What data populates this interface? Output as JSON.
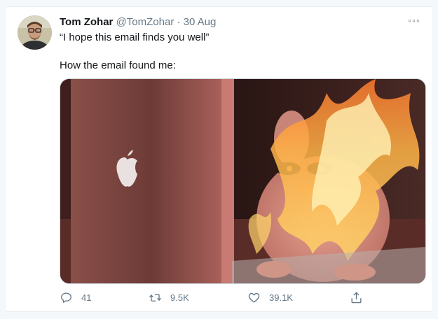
{
  "tweet": {
    "author_name": "Tom Zohar",
    "author_handle": "@TomZohar",
    "separator": "·",
    "date": "30 Aug",
    "text_line1": "“I hope this email finds you well”",
    "text_line2": "How the email found me:",
    "more_label": "◦◦◦"
  },
  "actions": {
    "replies": "41",
    "retweets": "9.5K",
    "likes": "39.1K"
  },
  "colors": {
    "text_primary": "#14171a",
    "text_secondary": "#657786",
    "border": "#e6ecf0",
    "background": "#f5f8fa"
  },
  "icons": [
    "avatar",
    "more-icon",
    "reply-icon",
    "retweet-icon",
    "like-icon",
    "share-icon"
  ]
}
